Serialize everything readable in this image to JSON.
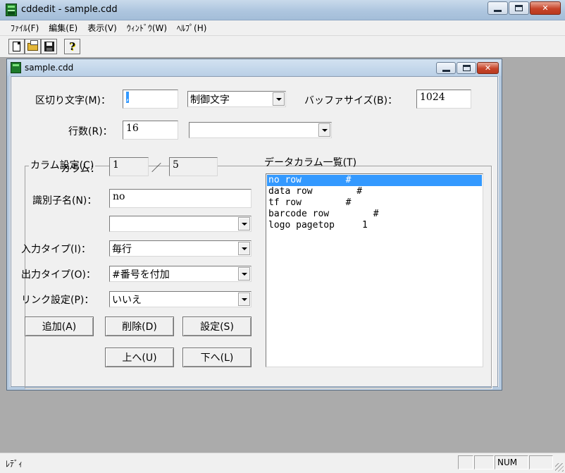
{
  "app": {
    "title": "cddedit - sample.cdd",
    "menu": [
      "ﾌｧｲﾙ(F)",
      "編集(E)",
      "表示(V)",
      "ｳｨﾝﾄﾞｳ(W)",
      "ﾍﾙﾌﾟ(H)"
    ],
    "toolbar": [
      {
        "name": "new-file-icon"
      },
      {
        "name": "open-folder-icon"
      },
      {
        "name": "save-disk-icon"
      },
      {
        "name": "help-icon",
        "glyph": "?"
      }
    ]
  },
  "child": {
    "title": "sample.cdd"
  },
  "form": {
    "delimiter_label": "区切り文字(M)：",
    "delimiter_value": ",",
    "delimiter_type": "制御文字",
    "buffer_label": "バッファサイズ(B)：",
    "buffer_value": "1024",
    "rows_label": "行数(R)：",
    "rows_value": "16",
    "rows_combo": "",
    "group_title": "カラム設定(C)",
    "column_label": "カラム：",
    "column_current": "1",
    "column_separator": "／",
    "column_total": "5",
    "identifier_label": "識別子名(N)：",
    "identifier_value": "no",
    "identifier_combo": "",
    "input_type_label": "入力タイプ(I)：",
    "input_type_value": "毎行",
    "output_type_label": "出力タイプ(O)：",
    "output_type_value": "#番号を付加",
    "link_label": "リンク設定(P)：",
    "link_value": "いいえ",
    "buttons": {
      "add": "追加(A)",
      "delete": "削除(D)",
      "set": "設定(S)",
      "up": "上へ(U)",
      "down": "下へ(L)"
    },
    "list_title": "データカラム一覧(T)",
    "list_items": [
      "no row        #",
      "data row        #",
      "tf row        #",
      "barcode row        #",
      "logo pagetop     1"
    ]
  },
  "status": {
    "text": "ﾚﾃﾞｨ",
    "num": "NUM"
  },
  "colors": {
    "selection": "#3399ff",
    "window_bg": "#f0f0f0",
    "mdi_bg": "#ababab"
  }
}
